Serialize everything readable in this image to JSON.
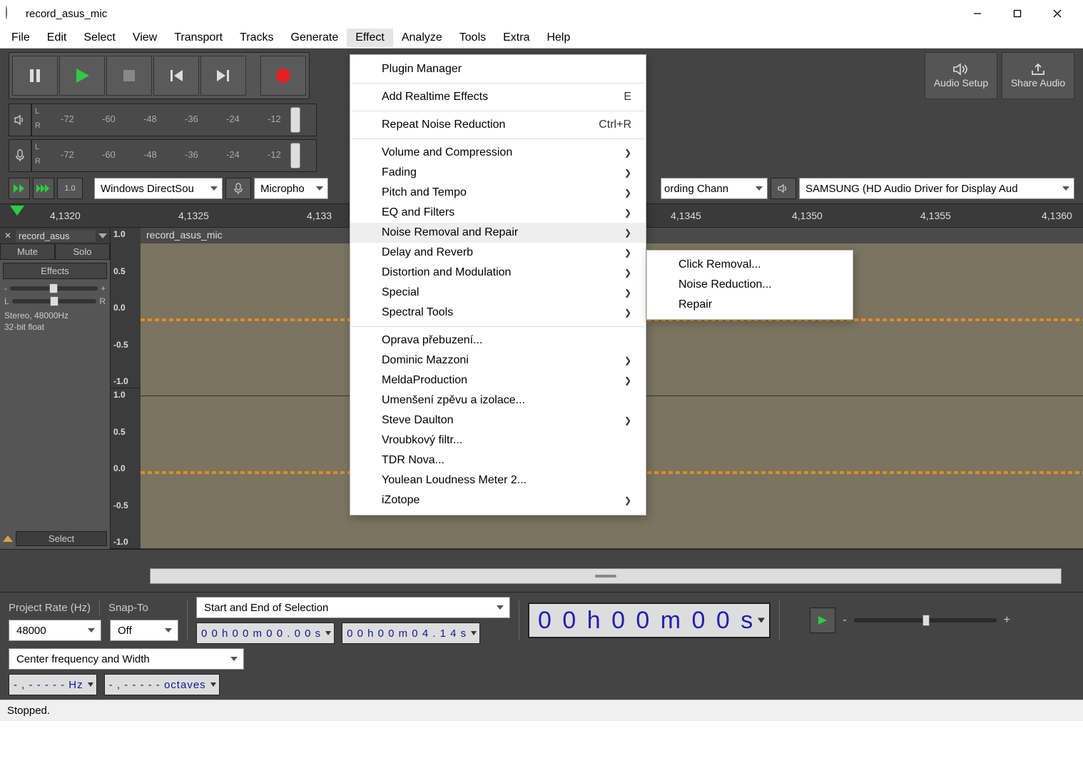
{
  "window": {
    "title": "record_asus_mic"
  },
  "menubar": [
    "File",
    "Edit",
    "Select",
    "View",
    "Transport",
    "Tracks",
    "Generate",
    "Effect",
    "Analyze",
    "Tools",
    "Extra",
    "Help"
  ],
  "menubar_open_index": 7,
  "big_buttons": {
    "audio_setup": "Audio Setup",
    "share_audio": "Share Audio"
  },
  "meter_ticks": [
    "-72",
    "-60",
    "-48",
    "-36",
    "-24",
    "-12"
  ],
  "meter_channels": [
    "L",
    "R"
  ],
  "devices": {
    "host": "Windows DirectSou",
    "rec_device_prefix": "Micropho",
    "rec_channels_suffix": "ording Chann",
    "play_device": "SAMSUNG (HD Audio Driver for Display Aud"
  },
  "timeline": {
    "labels": [
      "4,1320",
      "4,1325",
      "4,133",
      "4,1345",
      "4,1350",
      "4,1355",
      "4,1360"
    ]
  },
  "track": {
    "name": "record_asus",
    "clip_name": "record_asus_mic",
    "mute": "Mute",
    "solo": "Solo",
    "effects": "Effects",
    "gain_minus": "-",
    "gain_plus": "+",
    "pan_l": "L",
    "pan_r": "R",
    "info_line1": "Stereo, 48000Hz",
    "info_line2": "32-bit float",
    "select": "Select",
    "amp_labels": [
      "1.0",
      "0.5",
      "0.0",
      "-0.5",
      "-1.0"
    ]
  },
  "selection": {
    "project_rate_label": "Project Rate (Hz)",
    "snap_to_label": "Snap-To",
    "project_rate": "48000",
    "snap_to": "Off",
    "mode": "Start and End of Selection",
    "start_time": "0 0 h 0 0 m 0 0 . 0 0 s",
    "end_time": "0 0 h 0 0 m 0 4 . 1 4 s",
    "big_time": "0 0 h 0 0 m 0 0 s",
    "center_freq_label": "Center frequency and Width",
    "freq_box": "- , - - -  - -  Hz",
    "octave_box": "- , - - -  - -  octaves"
  },
  "playback_slider": {
    "minus": "-",
    "plus": "+"
  },
  "status": "Stopped.",
  "effect_menu": {
    "items": [
      {
        "label": "Plugin Manager",
        "type": "item"
      },
      {
        "type": "sep"
      },
      {
        "label": "Add Realtime Effects",
        "shortcut": "E",
        "type": "item"
      },
      {
        "type": "sep"
      },
      {
        "label": "Repeat Noise Reduction",
        "shortcut": "Ctrl+R",
        "type": "item"
      },
      {
        "type": "sep"
      },
      {
        "label": "Volume and Compression",
        "type": "submenu"
      },
      {
        "label": "Fading",
        "type": "submenu"
      },
      {
        "label": "Pitch and Tempo",
        "type": "submenu"
      },
      {
        "label": "EQ and Filters",
        "type": "submenu"
      },
      {
        "label": "Noise Removal and Repair",
        "type": "submenu",
        "highlighted": true
      },
      {
        "label": "Delay and Reverb",
        "type": "submenu"
      },
      {
        "label": "Distortion and Modulation",
        "type": "submenu"
      },
      {
        "label": "Special",
        "type": "submenu"
      },
      {
        "label": "Spectral Tools",
        "type": "submenu"
      },
      {
        "type": "sep"
      },
      {
        "label": "Oprava přebuzení...",
        "type": "item"
      },
      {
        "label": "Dominic Mazzoni",
        "type": "submenu"
      },
      {
        "label": "MeldaProduction",
        "type": "submenu"
      },
      {
        "label": "Umenšení zpěvu a izolace...",
        "type": "item"
      },
      {
        "label": "Steve Daulton",
        "type": "submenu"
      },
      {
        "label": "Vroubkový filtr...",
        "type": "item"
      },
      {
        "label": "TDR Nova...",
        "type": "item"
      },
      {
        "label": "Youlean Loudness Meter 2...",
        "type": "item"
      },
      {
        "label": "iZotope",
        "type": "submenu"
      }
    ]
  },
  "noise_submenu": [
    "Click Removal...",
    "Noise Reduction...",
    "Repair"
  ]
}
